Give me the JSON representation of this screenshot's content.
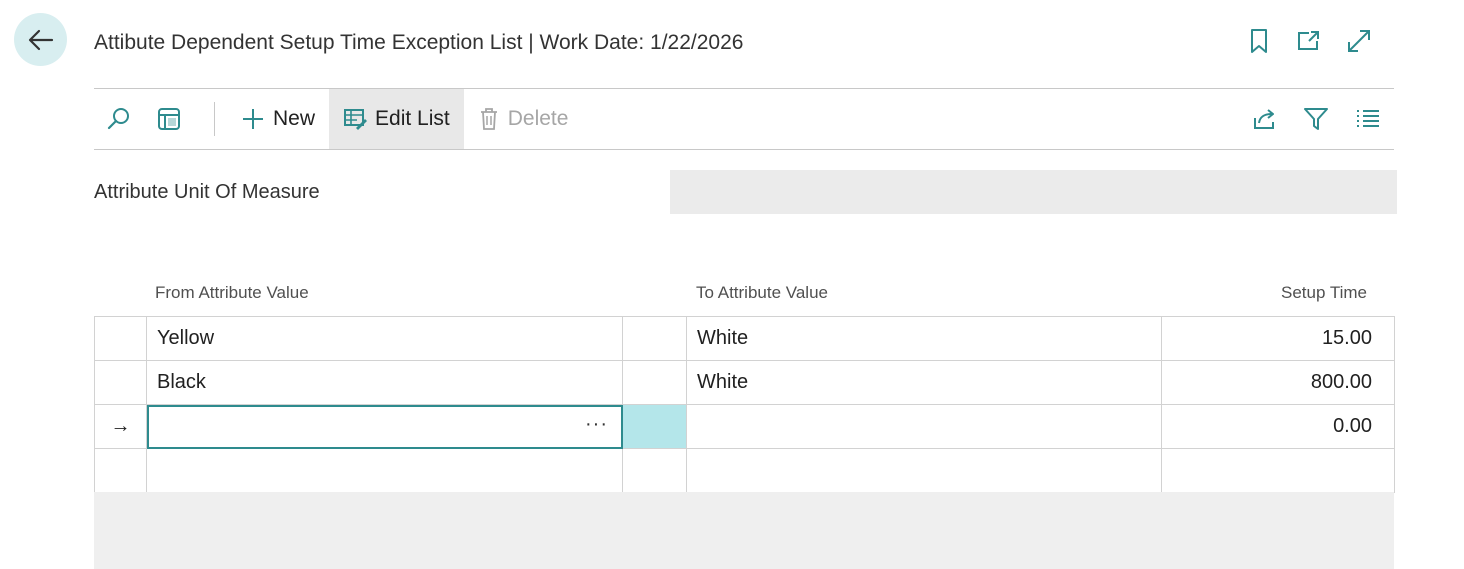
{
  "header": {
    "title": "Attibute Dependent Setup Time Exception List | Work Date: 1/22/2026"
  },
  "toolbar": {
    "new_label": "New",
    "edit_list_label": "Edit List",
    "delete_label": "Delete"
  },
  "filter": {
    "label": "Attribute Unit Of Measure",
    "value": ""
  },
  "table": {
    "columns": [
      "From Attribute Value",
      "To Attribute Value",
      "Setup Time"
    ],
    "rows": [
      {
        "indicator": "",
        "from": "Yellow",
        "to": "White",
        "setup_time": "15.00"
      },
      {
        "indicator": "",
        "from": "Black",
        "to": "White",
        "setup_time": "800.00"
      },
      {
        "indicator": "→",
        "from": "",
        "to": "",
        "setup_time": "0.00"
      },
      {
        "indicator": "",
        "from": "",
        "to": "",
        "setup_time": ""
      }
    ],
    "lookup_glyph": "···"
  },
  "colors": {
    "accent": "#2e8b8e",
    "back_bg": "#d8eef0",
    "active_cell": "#b4e6ea"
  },
  "icons": {
    "back": "arrow-left-icon",
    "bookmark": "bookmark-icon",
    "open_new": "open-in-new-window-icon",
    "expand": "expand-icon",
    "search": "search-icon",
    "layout": "layout-icon",
    "share": "share-icon",
    "filter": "filter-icon",
    "list": "list-icon"
  }
}
